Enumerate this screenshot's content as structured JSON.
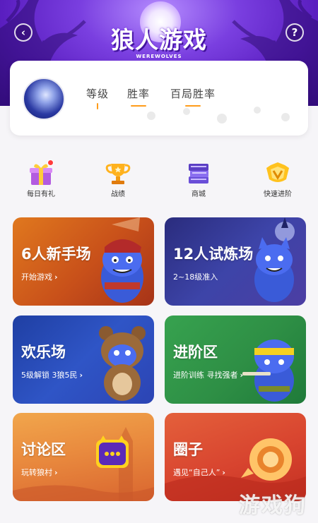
{
  "header": {
    "title": "狼人游戏",
    "subtitle": "WEREWOLVES",
    "back_icon": "back-icon",
    "help_icon": "help-icon",
    "back_symbol": "‹",
    "help_symbol": "?"
  },
  "profile": {
    "stats": [
      {
        "label": "等级"
      },
      {
        "label": "胜率"
      },
      {
        "label": "百局胜率"
      }
    ]
  },
  "quick_links": [
    {
      "label": "每日有礼",
      "icon": "gift-icon",
      "badge": true
    },
    {
      "label": "战绩",
      "icon": "trophy-icon"
    },
    {
      "label": "商城",
      "icon": "shop-books-icon"
    },
    {
      "label": "快速进阶",
      "icon": "level-up-icon"
    }
  ],
  "modes": [
    {
      "title": "6人新手场",
      "subtitle": "开始游戏",
      "color": "#d0621c"
    },
    {
      "title": "12人试炼场",
      "subtitle": "2~18级准入",
      "color": "#3a40a3"
    },
    {
      "title": "欢乐场",
      "subtitle": "5级解锁 3狼5民",
      "color": "#2b4fbf"
    },
    {
      "title": "进阶区",
      "subtitle": "进阶训练 寻找强者",
      "color": "#2f944a"
    },
    {
      "title": "讨论区",
      "subtitle": "玩转狼村",
      "color": "#e98a3e"
    },
    {
      "title": "圈子",
      "subtitle": "遇见“自己人”",
      "color": "#d8442f"
    }
  ],
  "chevron": "›",
  "watermark": "游戏狗"
}
